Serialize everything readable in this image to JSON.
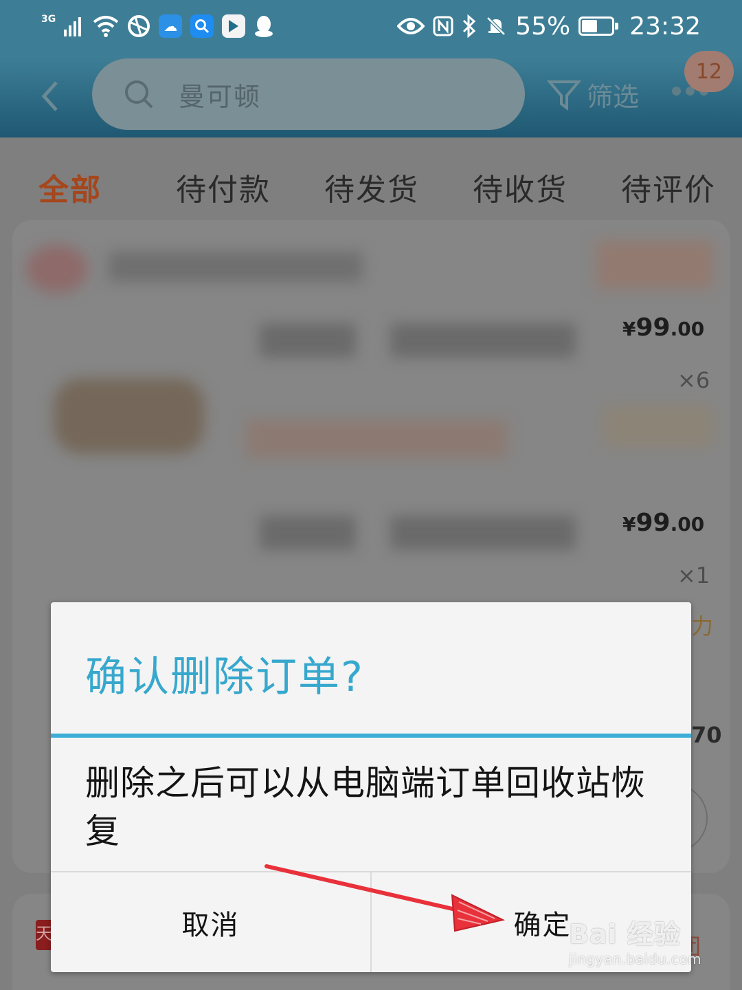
{
  "status_bar": {
    "network": "3G",
    "battery": "55%",
    "battery_level": 0.55,
    "time": "23:32",
    "app_icons": [
      "weather-cloud-icon",
      "search-app-icon",
      "video-app-icon",
      "qq-penguin-icon"
    ]
  },
  "header": {
    "search_query": "曼可顿",
    "filter_label": "筛选",
    "message_badge": "12"
  },
  "tabs": [
    {
      "label": "全部",
      "active": true
    },
    {
      "label": "待付款",
      "active": false
    },
    {
      "label": "待发货",
      "active": false
    },
    {
      "label": "待收货",
      "active": false
    },
    {
      "label": "待评价",
      "active": false
    }
  ],
  "orders": [
    {
      "price_symbol": "¥",
      "price_int": "99",
      "price_dec": ".00",
      "qty": "×6"
    },
    {
      "price_symbol": "¥",
      "price_int": "99",
      "price_dec": ".00",
      "qty": "×1"
    }
  ],
  "partial_texts": {
    "edge_1": "力",
    "edge_2": "70",
    "edge_3": "团",
    "tmall_logo": "天"
  },
  "dialog": {
    "title": "确认删除订单?",
    "message": "删除之后可以从电脑端订单回收站恢复",
    "cancel_label": "取消",
    "confirm_label": "确定",
    "accent_color": "#37a8cd"
  },
  "annotation": {
    "arrow_color": "#e8313a",
    "points_to": "confirm-button"
  },
  "watermark": {
    "main": "Bai 经验",
    "sub": "jingyan.baidu.com"
  }
}
